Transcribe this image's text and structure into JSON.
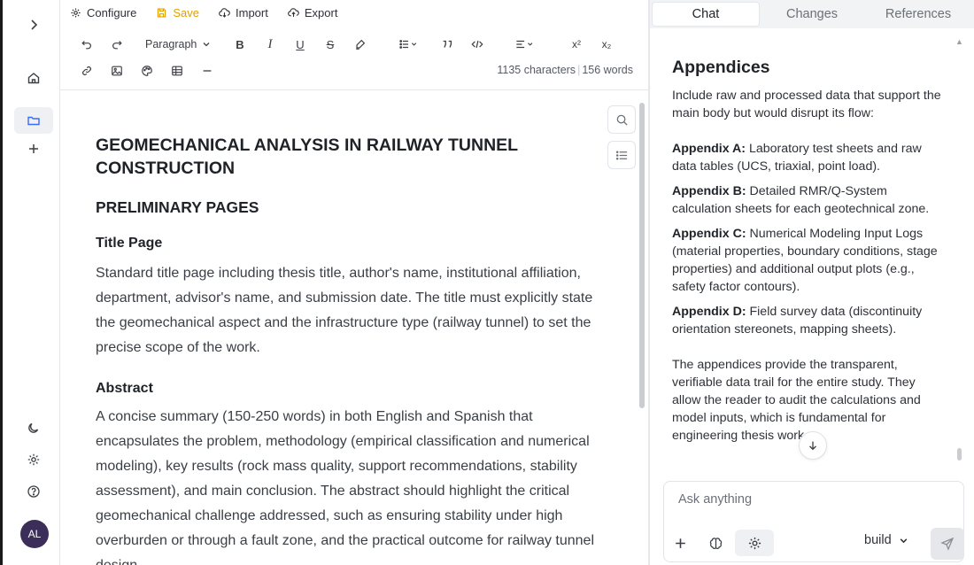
{
  "topbar": {
    "configure": "Configure",
    "save": "Save",
    "import": "Import",
    "export": "Export"
  },
  "toolbar": {
    "block_type": "Paragraph",
    "bold": "B",
    "italic": "I",
    "underline": "U",
    "strike": "S",
    "superscript": "x²",
    "subscript": "x₂",
    "char_count": "1135 characters",
    "word_count": "156 words"
  },
  "document": {
    "title": "GEOMECHANICAL ANALYSIS IN RAILWAY TUNNEL CONSTRUCTION",
    "section": "PRELIMINARY PAGES",
    "subsections": [
      {
        "heading": "Title Page",
        "body": "Standard title page including thesis title, author's name, institutional affiliation, department, advisor's name, and submission date. The title must explicitly state the geomechanical aspect and the infrastructure type (railway tunnel) to set the precise scope of the work."
      },
      {
        "heading": "Abstract",
        "body": "A concise summary (150-250 words) in both English and Spanish that encapsulates the problem, methodology (empirical classification and numerical modeling), key results (rock mass quality, support recommendations, stability assessment), and main conclusion. The abstract should highlight the critical geomechanical challenge addressed, such as ensuring stability under high overburden or through a fault zone, and the practical outcome for railway tunnel design."
      }
    ]
  },
  "panel": {
    "tabs": [
      "Chat",
      "Changes",
      "References"
    ],
    "active_tab": "Chat",
    "heading": "Appendices",
    "intro": "Include raw and processed data that support the main body but would disrupt its flow:",
    "items": [
      {
        "label": "Appendix A:",
        "text": " Laboratory test sheets and raw data tables (UCS, triaxial, point load)."
      },
      {
        "label": "Appendix B:",
        "text": " Detailed RMR/Q-System calculation sheets for each geotechnical zone."
      },
      {
        "label": "Appendix C:",
        "text": " Numerical Modeling Input Logs (material properties, boundary conditions, stage properties) and additional output plots (e.g., safety factor contours)."
      },
      {
        "label": "Appendix D:",
        "text": " Field survey data (discontinuity orientation stereonets, mapping sheets)."
      }
    ],
    "closing": "The appendices provide the transparent, verifiable data trail for the entire study. They allow the reader to audit the calculations and model inputs, which is fundamental for engineering thesis work.",
    "input_placeholder": "Ask anything",
    "mode": "build"
  },
  "user": {
    "initials": "AL"
  },
  "colors": {
    "accent": "#3b6cf6",
    "save": "#e0a100",
    "avatar": "#3b2f5a"
  }
}
